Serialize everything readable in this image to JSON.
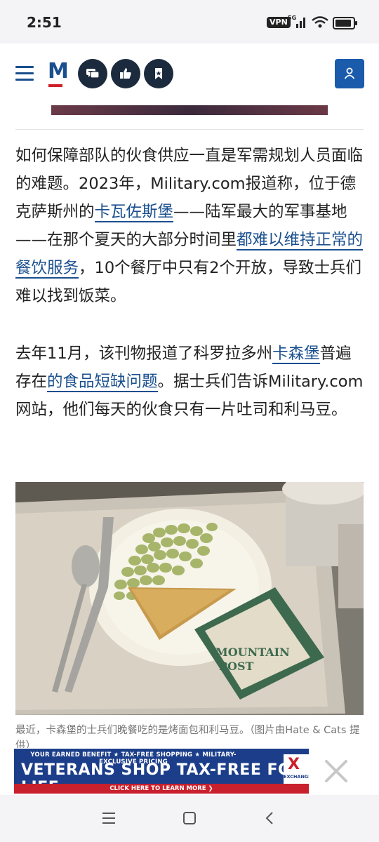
{
  "status_bar": {
    "time": "2:51",
    "vpn": "VPN",
    "network": "5G"
  },
  "header": {
    "logo_letter": "M",
    "icons": [
      "menu-icon",
      "comments-icon",
      "thumbs-up-icon",
      "bookmark-icon",
      "account-icon"
    ]
  },
  "article": {
    "p1": {
      "t1": "如何保障部队的伙食供应一直是军需规划人员面临的难题。2023年，Military.com报道称，位于德克萨斯州的",
      "link1": "卡瓦佐斯堡",
      "t2": "——陆军最大的军事基地——在那个夏天的大部分时间里",
      "link2": "都难以维持正常的餐饮服务",
      "t3": "，10个餐厅中只有2个开放，导致士兵们难以找到饭菜。"
    },
    "p2": {
      "t1": "去年11月，该刊物报道了科罗拉多州",
      "link1": "卡森堡",
      "t2": "普遍存在",
      "link2": "的食品短缺问题",
      "t3": "。据士兵们告诉Military.com网站，他们每天的伙食只有一片吐司和利马豆。"
    },
    "photo_sign_text": [
      "MOUNTAIN",
      "POST"
    ],
    "caption": "最近，卡森堡的士兵们晚餐吃的是烤面包和利马豆。（图片由Hate & Cats 提供）"
  },
  "ad": {
    "top_line": "YOUR EARNED BENEFIT ★ TAX-FREE SHOPPING ★ MILITARY-EXCLUSIVE PRICING",
    "headline": "VETERANS SHOP TAX-FREE FOR LIFE",
    "cta": "CLICK HERE TO LEARN MORE ❯",
    "brand_mark": "X",
    "brand_name": "EXCHANGE"
  }
}
